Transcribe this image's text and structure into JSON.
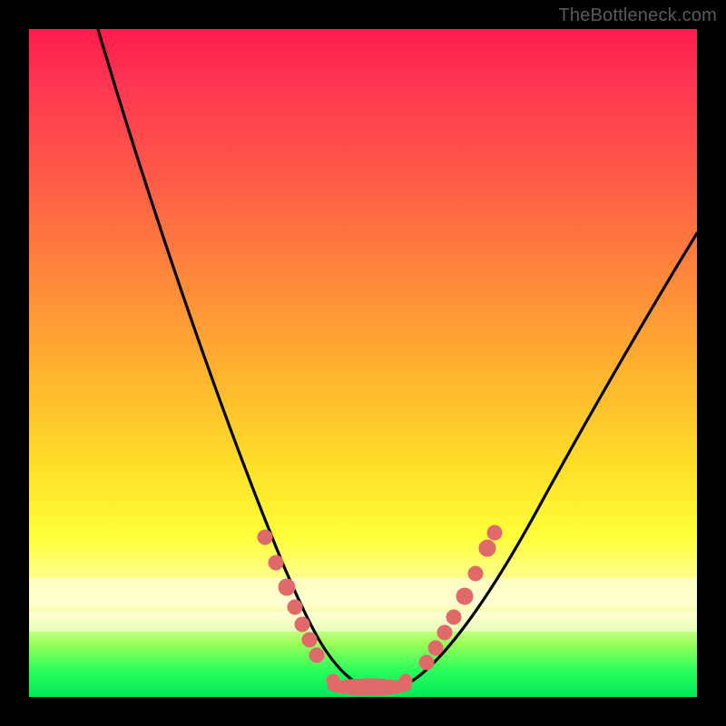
{
  "watermark": "TheBottleneck.com",
  "colors": {
    "background": "#000000",
    "gradient_top": "#ff1a4d",
    "gradient_mid": "#ffe028",
    "gradient_bottom": "#00e85c",
    "curve": "#000000",
    "markers": "#e06a6a"
  },
  "chart_data": {
    "type": "line",
    "title": "",
    "xlabel": "",
    "ylabel": "",
    "xlim": [
      0,
      100
    ],
    "ylim": [
      0,
      100
    ],
    "grid": false,
    "legend": false,
    "note": "Axes are unlabeled; values are estimated from pixel positions on a 0–100 normalized scale. y is the height of the black curve above the bottom of the gradient area (0 = bottom/green, 100 = top/red).",
    "series": [
      {
        "name": "bottleneck-curve",
        "x": [
          0,
          5,
          10,
          15,
          20,
          25,
          30,
          33,
          36,
          39,
          42,
          44,
          46,
          48,
          50,
          52,
          54,
          56,
          58,
          60,
          63,
          66,
          70,
          75,
          80,
          85,
          90,
          95,
          100
        ],
        "y": [
          120,
          108,
          96,
          84,
          71,
          58,
          45,
          37,
          30,
          23,
          16,
          11,
          7,
          4,
          2,
          1,
          1,
          2,
          4,
          7,
          12,
          18,
          26,
          35,
          44,
          52,
          59,
          66,
          72
        ]
      }
    ],
    "markers": {
      "name": "highlight-dots",
      "note": "Salmon dots clustered on both flanks near the valley, plus a flat cluster across the valley floor.",
      "x": [
        36,
        38,
        40,
        41,
        42,
        43,
        46,
        48,
        49,
        50,
        51,
        52,
        53,
        54,
        58,
        59,
        60,
        61,
        63,
        64,
        66
      ],
      "y": [
        30,
        25,
        20,
        17,
        15,
        12,
        3,
        2,
        1.5,
        1.2,
        1.2,
        1.5,
        2,
        3,
        9,
        11,
        13,
        15,
        19,
        21,
        25
      ]
    },
    "pale_bands_y": [
      {
        "from": 14,
        "to": 18
      },
      {
        "from": 10,
        "to": 13
      }
    ]
  }
}
